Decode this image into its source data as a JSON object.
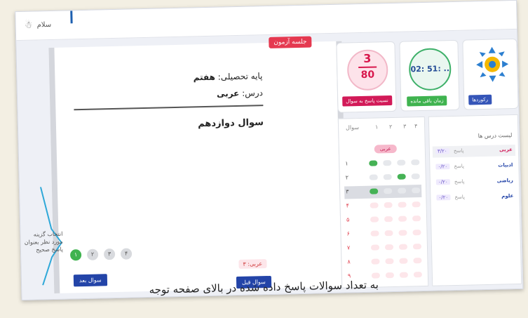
{
  "header": {
    "user_name": "سلام"
  },
  "toolbar": {
    "exam_info_label": "جلسه آزمون"
  },
  "question": {
    "grade_label": "پایه تحصیلی:",
    "grade_value": "هفتم",
    "subject_label": "درس:",
    "subject_value": "عربی",
    "title": "سوال دوازدهم",
    "options": [
      "۱",
      "۲",
      "۳",
      "۴"
    ],
    "selected_option": 1,
    "page_badge": "عربی: ۳",
    "next_button": "سوال بعد",
    "prev_button": "سوال قبل"
  },
  "score_card": {
    "answered": "3",
    "total": "80",
    "button": "نسبت پاسخ به سوال"
  },
  "timer_card": {
    "time": "02: 51: ..",
    "button": "زمان باقی مانده"
  },
  "logo_card": {
    "button": "رکوردها"
  },
  "answer_grid": {
    "header": [
      "سوال",
      "۱",
      "۲",
      "۳",
      "۴"
    ],
    "subject_pill": "عربی",
    "rows": [
      {
        "num": "۱",
        "selected": 1,
        "style": "normal"
      },
      {
        "num": "۲",
        "selected": 3,
        "style": "normal"
      },
      {
        "num": "۳",
        "selected": 1,
        "style": "highlight"
      },
      {
        "num": "۴",
        "selected": 0,
        "style": "pink"
      },
      {
        "num": "۵",
        "selected": 0,
        "style": "pink"
      },
      {
        "num": "۶",
        "selected": 0,
        "style": "pink"
      },
      {
        "num": "۷",
        "selected": 0,
        "style": "pink"
      },
      {
        "num": "۸",
        "selected": 0,
        "style": "pink"
      },
      {
        "num": "۹",
        "selected": 0,
        "style": "pink"
      }
    ]
  },
  "subject_list": {
    "title": "لیست درس ها",
    "items": [
      {
        "name": "عربی",
        "count": "۳/۲۰",
        "status": "پاسخ",
        "active": true
      },
      {
        "name": "ادبیات",
        "count": "۰/۲۰",
        "status": "پاسخ",
        "active": false
      },
      {
        "name": "ریاضی",
        "count": "۰/۲۰",
        "status": "پاسخ",
        "active": false
      },
      {
        "name": "علوم",
        "count": "۰/۲۰",
        "status": "پاسخ",
        "active": false
      }
    ]
  },
  "callout": {
    "text": "انتخاب گزینه مورد نظر بعنوان پاسخ صحیح"
  },
  "caption": "به تعداد سوالات پاسخ داده شده در بالای صفحه توجه"
}
